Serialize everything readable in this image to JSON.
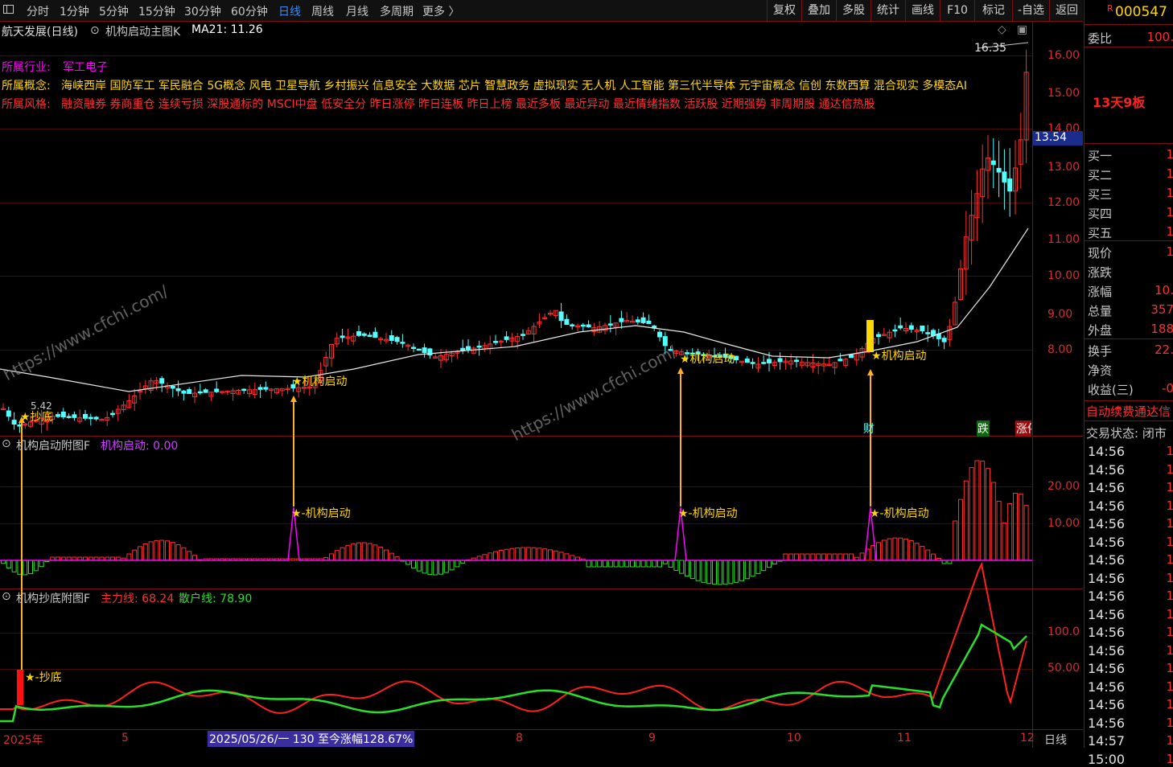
{
  "toolbar": {
    "periods": [
      "分时",
      "1分钟",
      "5分钟",
      "15分钟",
      "30分钟",
      "60分钟",
      "日线",
      "周线",
      "月线",
      "多周期",
      "更多 〉"
    ],
    "active_period": "日线",
    "right_buttons": [
      "复权",
      "叠加",
      "多股",
      "统计",
      "画线",
      "F10",
      "标记",
      "-自选",
      "返回"
    ]
  },
  "main_chart": {
    "title": "航天发展(日线)",
    "indicator_name": "机构启动主图K",
    "ma_label": "MA21: 11.26",
    "industry_label": "所属行业:",
    "industry": "军工电子",
    "concept_label": "所属概念:",
    "concepts": "海峡西岸 国防军工 军民融合 5G概念 风电 卫星导航 乡村振兴 信息安全 大数据 芯片 智慧政务 虚拟现实 无人机 人工智能 第三代半导体 元宇宙概念 信创 东数西算 混合现实 多模态AI",
    "style_label": "所属风格:",
    "styles": "融资融券 券商重仓 连续亏损 深股通标的 MSCI中盘 低安全分 昨日涨停 昨日连板 昨日上榜 最近多板 最近异动 最近情绪指数 活跃股 近期强势 非周期股 通达信热股",
    "high_label": "16.35",
    "current_price": "13.54",
    "y_ticks": [
      "16.00",
      "15.00",
      "14.00",
      "13.00",
      "12.00",
      "11.00",
      "10.00",
      "9.00",
      "8.00"
    ],
    "signals": [
      "★机构启动",
      "★机构启动",
      "★机构启动"
    ],
    "bottom_signal": "★抄底",
    "low_label": "5.42",
    "badges": [
      "财",
      "跌",
      "涨停"
    ],
    "watermark": "https://www.cfchi.com/"
  },
  "sub1": {
    "title": "机构启动附图F",
    "value_label": "机构启动: 0.00",
    "y_ticks": [
      "20.00",
      "10.00"
    ],
    "signals": [
      "★-机构启动",
      "★-机构启动",
      "★-机构启动"
    ]
  },
  "sub2": {
    "title": "机构抄底附图F",
    "main_line": "主力线: 68.24",
    "retail_line": "散户线: 78.90",
    "y_ticks": [
      "100.0",
      "50.00"
    ],
    "signal": "★-抄底"
  },
  "x_axis": {
    "labels": [
      "2025年",
      "5",
      "8",
      "9",
      "10",
      "11",
      "12"
    ],
    "info": "2025/05/26/一 130 至今涨幅128.67%",
    "period": "日线"
  },
  "right_panel": {
    "code": "000547",
    "code_prefix": "R",
    "weibi_label": "委比",
    "weibi_value": "100.",
    "board_info": "13天9板",
    "buy": [
      {
        "label": "买一",
        "value": "1"
      },
      {
        "label": "买二",
        "value": "1"
      },
      {
        "label": "买三",
        "value": "1"
      },
      {
        "label": "买四",
        "value": "1"
      },
      {
        "label": "买五",
        "value": "1"
      }
    ],
    "stats": [
      {
        "label": "现价",
        "value": "1"
      },
      {
        "label": "涨跌",
        "value": ""
      },
      {
        "label": "涨幅",
        "value": "10."
      },
      {
        "label": "总量",
        "value": "357"
      },
      {
        "label": "外盘",
        "value": "188"
      }
    ],
    "stats2": [
      {
        "label": "换手",
        "value": "22."
      },
      {
        "label": "净资",
        "value": ""
      },
      {
        "label": "收益(三)",
        "value": "-0"
      }
    ],
    "notice": "自动续费通达信",
    "trade_status": "交易状态: 闭市",
    "ticks": [
      "14:56",
      "14:56",
      "14:56",
      "14:56",
      "14:56",
      "14:56",
      "14:56",
      "14:56",
      "14:56",
      "14:56",
      "14:56",
      "14:56",
      "14:56",
      "14:56",
      "14:56",
      "14:56",
      "14:57",
      "15:00"
    ],
    "tick_values": [
      "1",
      "1",
      "1",
      "1",
      "1",
      "1",
      "1",
      "1",
      "1",
      "1",
      "1",
      "1",
      "1",
      "1",
      "1",
      "1",
      "1",
      "1"
    ]
  },
  "colors": {
    "up": "#ff3030",
    "down": "#54ffff",
    "ma": "#e8e8e8",
    "signal": "#ffd700",
    "magenta": "#ff00ff",
    "grid": "#7a1010",
    "green": "#28e028"
  }
}
